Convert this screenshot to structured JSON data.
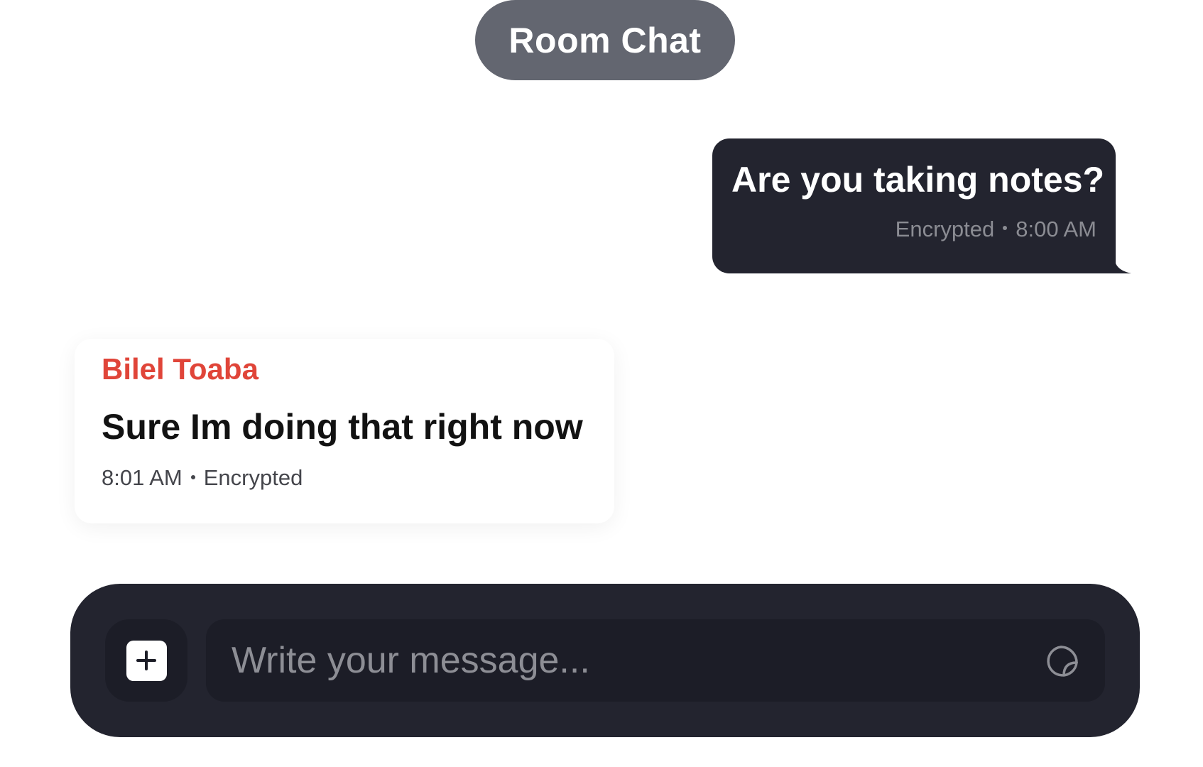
{
  "header": {
    "title": "Room Chat"
  },
  "messages": {
    "outgoing": {
      "text": "Are you taking notes?",
      "status": "Encrypted",
      "time": "8:00 AM"
    },
    "incoming": {
      "sender": "Bilel Toaba",
      "text": "Sure Im doing that right now",
      "time": "8:01 AM",
      "status": "Encrypted"
    }
  },
  "composer": {
    "placeholder": "Write your message...",
    "value": "",
    "add_icon": "plus-square-icon",
    "sticker_icon": "sticker-icon"
  },
  "colors": {
    "pill_background": "#636670",
    "bubble_background": "#23242f",
    "sender_name": "#e04539",
    "composer_background": "#23242f",
    "composer_inner": "#1c1d27"
  }
}
